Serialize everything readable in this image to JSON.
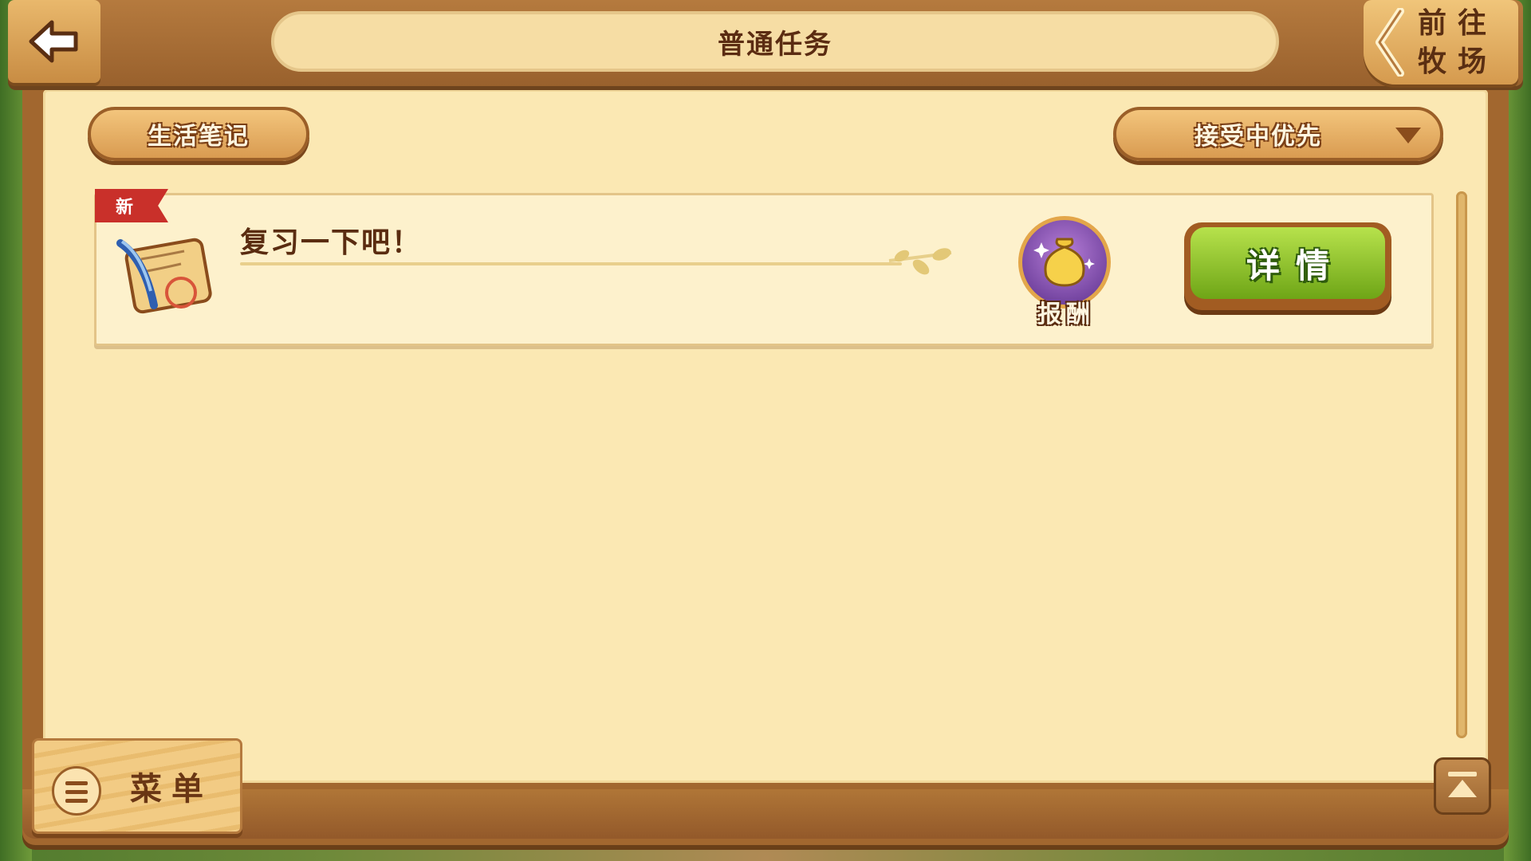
{
  "header": {
    "title": "普通任务",
    "back_icon": "arrow-left-icon",
    "ranch_button_label": "前往牧场"
  },
  "filters": {
    "tab_label": "生活笔记",
    "sort_label": "接受中优先"
  },
  "tasks": [
    {
      "badge": "新",
      "title": "复习一下吧！",
      "reward_label": "报酬",
      "detail_label": "详情",
      "icon": "scroll-quill-icon",
      "reward_icon": "money-bag-icon"
    }
  ],
  "footer": {
    "menu_label": "菜单"
  },
  "colors": {
    "accent_green": "#8bc22a",
    "wood_brown": "#a2672f",
    "paper": "#fbe8b3",
    "new_badge_red": "#c9302a"
  }
}
